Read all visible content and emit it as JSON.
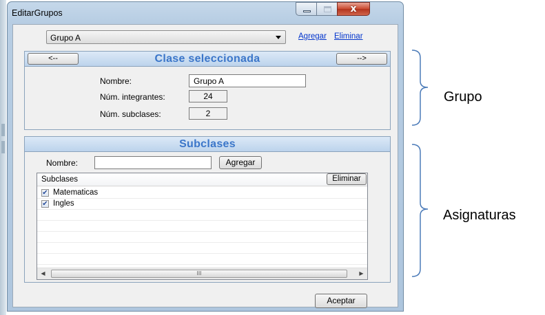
{
  "window": {
    "title": "EditarGrupos",
    "close_glyph": "x"
  },
  "top": {
    "group_select_value": "Grupo A",
    "add_link": "Agregar",
    "remove_link": "Eliminar"
  },
  "clase_panel": {
    "title": "Clase seleccionada",
    "prev_label": "<--",
    "next_label": "-->",
    "nombre_label": "Nombre:",
    "nombre_value": "Grupo A",
    "integrantes_label": "Núm. integrantes:",
    "integrantes_value": "24",
    "subclases_label": "Núm. subclases:",
    "subclases_value": "2"
  },
  "subclases_panel": {
    "title": "Subclases",
    "nombre_label": "Nombre:",
    "nombre_value": "",
    "add_button": "Agregar",
    "list_header": "Subclases",
    "remove_button": "Eliminar",
    "items": [
      {
        "label": "Matematicas",
        "checked": true
      },
      {
        "label": "Ingles",
        "checked": true
      }
    ],
    "scroll_thumb_glyph": "III"
  },
  "footer": {
    "accept_button": "Aceptar"
  },
  "annotations": {
    "grupo": "Grupo",
    "asignaturas": "Asignaturas"
  },
  "icons": {
    "minimize": "minimize-icon",
    "maximize": "maximize-icon",
    "close": "close-icon",
    "dropdown": "chevron-down-icon",
    "checkbox": "checkbox-checked-icon",
    "scroll_left": "arrow-left-icon",
    "scroll_right": "arrow-right-icon"
  },
  "colors": {
    "panel_title": "#3b76c9",
    "link": "#0033cc",
    "close_button": "#c9492f"
  }
}
